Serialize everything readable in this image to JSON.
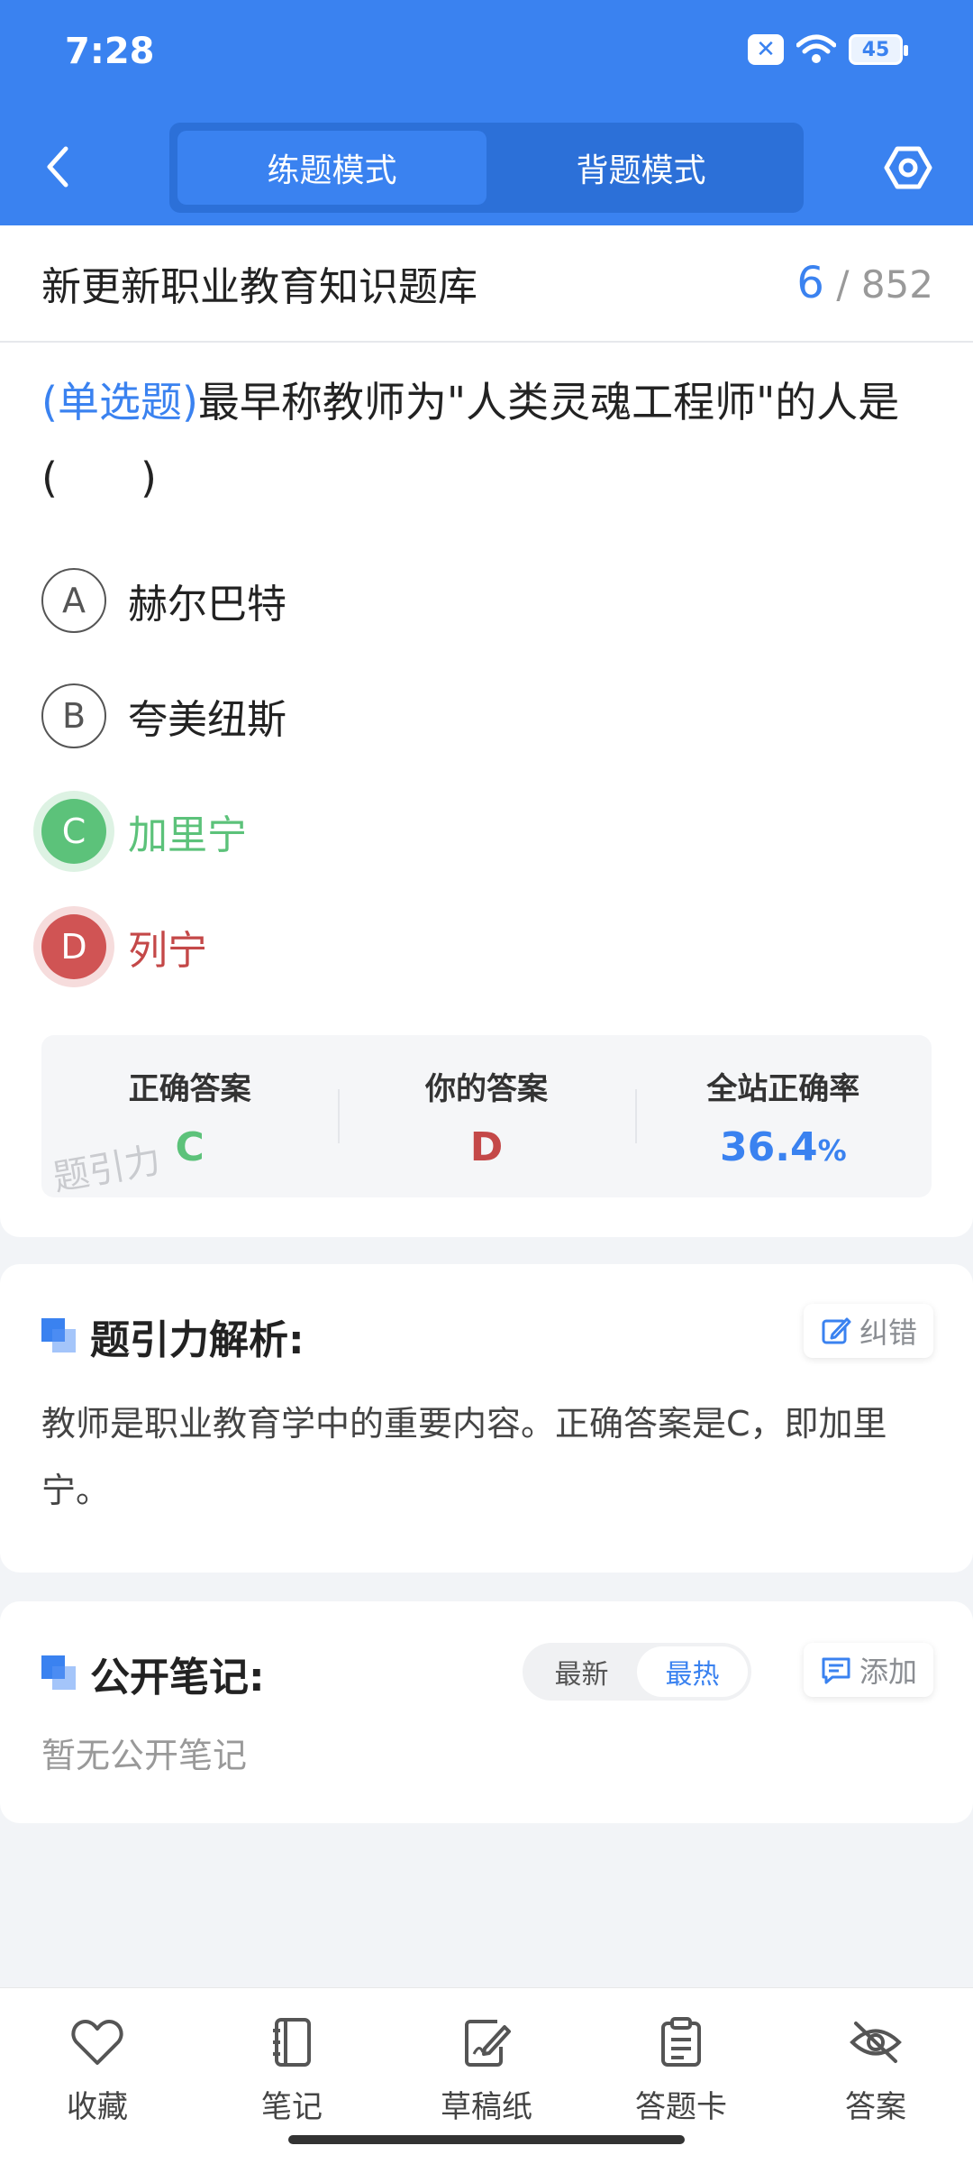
{
  "status_bar": {
    "time": "7:28",
    "battery": "45"
  },
  "header": {
    "tabs": [
      {
        "label": "练题模式",
        "active": true
      },
      {
        "label": "背题模式",
        "active": false
      }
    ]
  },
  "question_card": {
    "bank_title": "新更新职业教育知识题库",
    "progress_current": "6",
    "progress_total": "/ 852",
    "question_type": "(单选题)",
    "question_text": "最早称教师为\"人类灵魂工程师\"的人是(　　)",
    "options": [
      {
        "letter": "A",
        "text": "赫尔巴特",
        "state": "normal"
      },
      {
        "letter": "B",
        "text": "夸美纽斯",
        "state": "normal"
      },
      {
        "letter": "C",
        "text": "加里宁",
        "state": "correct"
      },
      {
        "letter": "D",
        "text": "列宁",
        "state": "wrong"
      }
    ],
    "stats": {
      "correct_label": "正确答案",
      "correct_value": "C",
      "yours_label": "你的答案",
      "yours_value": "D",
      "rate_label": "全站正确率",
      "rate_value": "36.4",
      "rate_unit": "%"
    },
    "watermark": "题引力"
  },
  "analysis": {
    "title": "题引力解析:",
    "report_label": "纠错",
    "text": "教师是职业教育学中的重要内容。正确答案是C，即加里宁。"
  },
  "notes": {
    "title": "公开笔记:",
    "sort_options": [
      "最新",
      "最热"
    ],
    "sort_active": "最热",
    "add_label": "添加",
    "empty_text": "暂无公开笔记"
  },
  "bottom_nav": [
    {
      "label": "收藏",
      "icon": "heart-icon"
    },
    {
      "label": "笔记",
      "icon": "notebook-icon"
    },
    {
      "label": "草稿纸",
      "icon": "draft-icon"
    },
    {
      "label": "答题卡",
      "icon": "clipboard-icon"
    },
    {
      "label": "答案",
      "icon": "eye-off-icon"
    }
  ],
  "colors": {
    "primary": "#3A82F0",
    "correct": "#5CC27A",
    "wrong": "#C44848"
  }
}
